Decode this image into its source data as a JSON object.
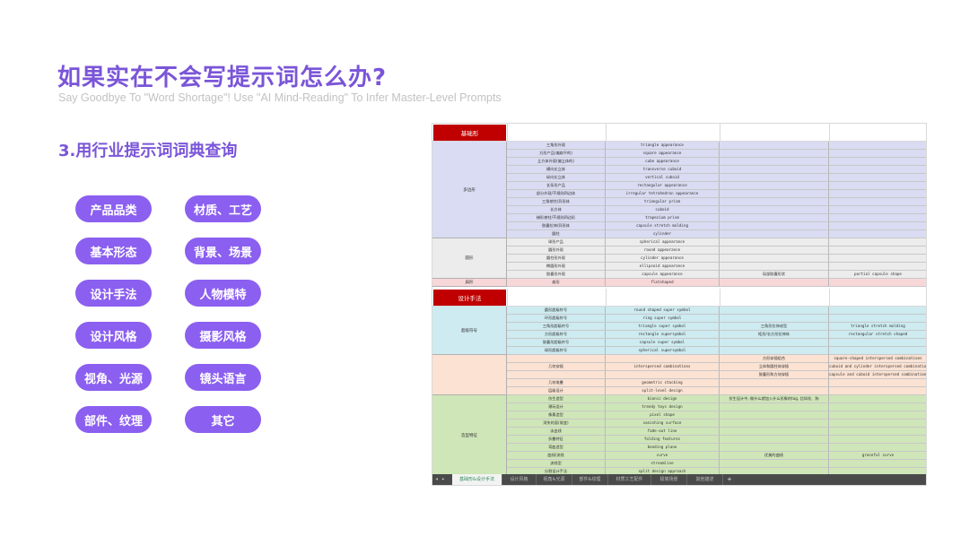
{
  "page": {
    "title": "如果实在不会写提示词怎么办?",
    "subtitle": "Say Goodbye To \"Word Shortage\"! Use \"AI Mind-Reading\" To Infer Master-Level Prompts",
    "section": "3.用行业提示词词典查询",
    "accent": "#7a55d8",
    "pill_color": "#8b5ff0"
  },
  "pills": [
    "产品品类",
    "材质、工艺",
    "基本形态",
    "背景、场景",
    "设计手法",
    "人物模特",
    "设计风格",
    "摄影风格",
    "视角、光源",
    "镜头语言",
    "部件、纹理",
    "其它"
  ],
  "sheet": {
    "headers": {
      "basic": "基础形",
      "design": "设计手法"
    },
    "groups": [
      {
        "label": "多边形",
        "color": "#d9dcf2",
        "rows": [
          [
            "三角形外观",
            "triangle appearance",
            "",
            ""
          ],
          [
            "方形产品(偏扁平的)",
            "square appearance",
            "",
            ""
          ],
          [
            "立方体外观(偏立体的)",
            "cube appearance",
            "",
            ""
          ],
          [
            "横向长立体",
            "transverse cuboid",
            "",
            ""
          ],
          [
            "纵向长立体",
            "vertical cuboid",
            "",
            ""
          ],
          [
            "长条形产品",
            "rectangular appearance",
            "",
            ""
          ],
          [
            "部分外观/不规则四边体",
            "irregular tetrahedron appearance",
            "",
            ""
          ],
          [
            "三角棱柱/异形体",
            "triangular prism",
            "",
            ""
          ],
          [
            "长方体",
            "cuboid",
            "",
            ""
          ],
          [
            "梯形棱柱/不规则四边形",
            "trapezium prism",
            "",
            ""
          ],
          [
            "胶囊拉伸/异形体",
            "capsule stretch molding",
            "",
            ""
          ],
          [
            "圆柱",
            "cylinder",
            "",
            ""
          ]
        ]
      },
      {
        "label": "圆形",
        "color": "#ececec",
        "rows": [
          [
            "球形产品",
            "spherical appearance",
            "",
            ""
          ],
          [
            "圆形外观",
            "round appearance",
            "",
            ""
          ],
          [
            "圆柱形外观",
            "cylinder appearance",
            "",
            ""
          ],
          [
            "椭圆形外观",
            "ellipsoid appearance",
            "",
            ""
          ],
          [
            "胶囊形外观",
            "capsule appearance",
            "局部胶囊形状",
            "partial capsule shape"
          ]
        ]
      },
      {
        "label": "扁形",
        "color": "#f8d7d9",
        "rows": [
          [
            "扁形",
            "flatshaped",
            "",
            ""
          ]
        ]
      }
    ],
    "groups2": [
      {
        "label": "超级符号",
        "color": "#cdebf0",
        "rows": [
          [
            "圆形超级符号",
            "round shaped super symbol",
            "",
            ""
          ],
          [
            "环形超级符号",
            "ring super symbol",
            "",
            ""
          ],
          [
            "三角形超级符号",
            "triangle super symbol",
            "三角形拉伸成型",
            "triangle stretch molding"
          ],
          [
            "方形超级符号",
            "rectangle supersymbol",
            "矩形/长方形拉伸体",
            "rectangular stretch shaped"
          ],
          [
            "胶囊形超级符号",
            "capsule super symbol",
            "",
            ""
          ],
          [
            "球形超级符号",
            "spherical supersymbol",
            "",
            ""
          ]
        ]
      },
      {
        "label": "",
        "color": "#fbe2d2",
        "rows": [
          [
            "",
            "",
            "方形穿插组合",
            "square-shaped interspersed combinations"
          ],
          [
            "几何穿插",
            "interspersed combinations",
            "立体和圆柱体穿插",
            "cuboid and cylinder interspersed combinations"
          ],
          [
            "",
            "",
            "胶囊形和方块穿插",
            "capsule and cuboid interspersed combinations"
          ],
          [
            "几何堆叠",
            "geometric stacking",
            "",
            ""
          ],
          [
            "层级设计",
            "split-level design",
            "",
            ""
          ]
        ]
      },
      {
        "label": "造型特征",
        "color": "#cfe6b8",
        "rows": [
          [
            "仿生造型",
            "bionic design",
            "仿生设计中, 做什么就加入什么形象的tag, 比如花、狗",
            ""
          ],
          [
            "潮玩设计",
            "trendy toys design",
            "",
            ""
          ],
          [
            "像素造型",
            "pixel shape",
            "",
            ""
          ],
          [
            "消失的面(渐变)",
            "vanishing surface",
            "",
            ""
          ],
          [
            "淡出线",
            "fade-out line",
            "",
            ""
          ],
          [
            "折叠特征",
            "folding features",
            "",
            ""
          ],
          [
            "弯曲造型",
            "bending plane",
            "",
            ""
          ],
          [
            "曲线/流线",
            "curve",
            "优美的曲线",
            "graceful curve"
          ],
          [
            "流线型",
            "streamline",
            "",
            ""
          ],
          [
            "分割设计手法",
            "split design approach",
            "",
            ""
          ]
        ]
      }
    ],
    "tabs": [
      "基础形&设计手法",
      "设计风格",
      "视角&光源",
      "部件&纹理",
      "材质工艺配件",
      "极简场景",
      "其他描述"
    ],
    "tab_plus": "+"
  }
}
